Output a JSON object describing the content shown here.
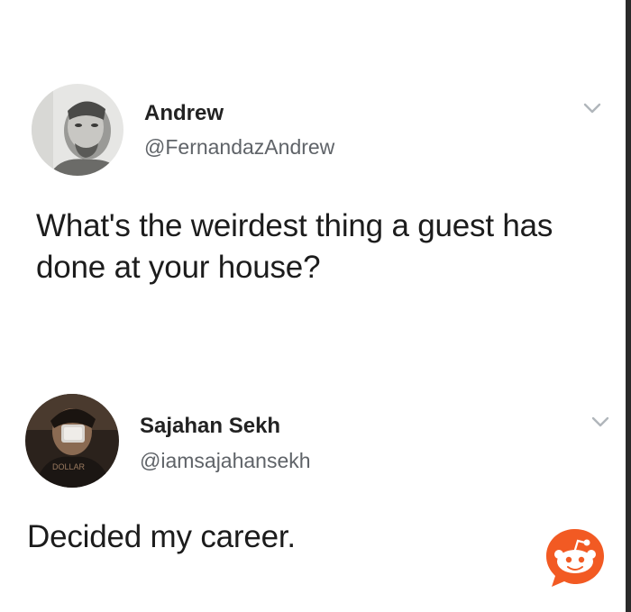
{
  "tweets": [
    {
      "name": "Andrew",
      "handle": "@FernandazAndrew",
      "text": "What's the weirdest thing a guest has done at your house?",
      "menu_icon": "chevron-down-icon"
    },
    {
      "name": "Sajahan Sekh",
      "handle": "@iamsajahansekh",
      "text": "Decided my career.",
      "menu_icon": "chevron-down-icon"
    }
  ],
  "watermark": {
    "icon": "reddit-icon",
    "color": "#f25a23"
  },
  "colors": {
    "name": "#222222",
    "handle": "#5f6368",
    "chevron": "#b0b6bb"
  }
}
